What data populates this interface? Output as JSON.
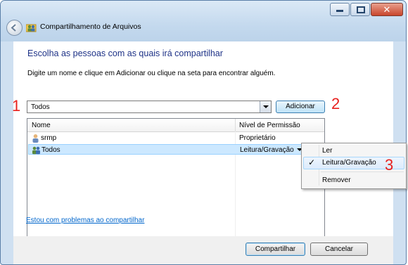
{
  "window": {
    "title": "Compartilhamento de Arquivos",
    "close_glyph": "✕"
  },
  "content": {
    "heading": "Escolha as pessoas com as quais irá compartilhar",
    "instructions": "Digite um nome e clique em Adicionar ou clique na seta para encontrar alguém.",
    "combo_value": "Todos",
    "add_label": "Adicionar",
    "help_link": "Estou com problemas ao compartilhar"
  },
  "list": {
    "columns": [
      "Nome",
      "Nível de Permissão"
    ],
    "rows": [
      {
        "name": "srmp",
        "permission": "Proprietário",
        "icon": "user-icon"
      },
      {
        "name": "Todos",
        "permission": "Leitura/Gravação",
        "icon": "users-group-icon",
        "selected": true
      }
    ]
  },
  "menu": {
    "items": [
      "Ler",
      "Leitura/Gravação",
      "Remover"
    ],
    "checked_item": "Leitura/Gravação",
    "check_glyph": "✓"
  },
  "footer": {
    "share_label": "Compartilhar",
    "cancel_label": "Cancelar"
  },
  "annotations": [
    "1",
    "2",
    "3"
  ],
  "colors": {
    "heading": "#1e3287",
    "link": "#0066cc",
    "selection": "#cce8ff",
    "annotation": "#e8211e"
  }
}
